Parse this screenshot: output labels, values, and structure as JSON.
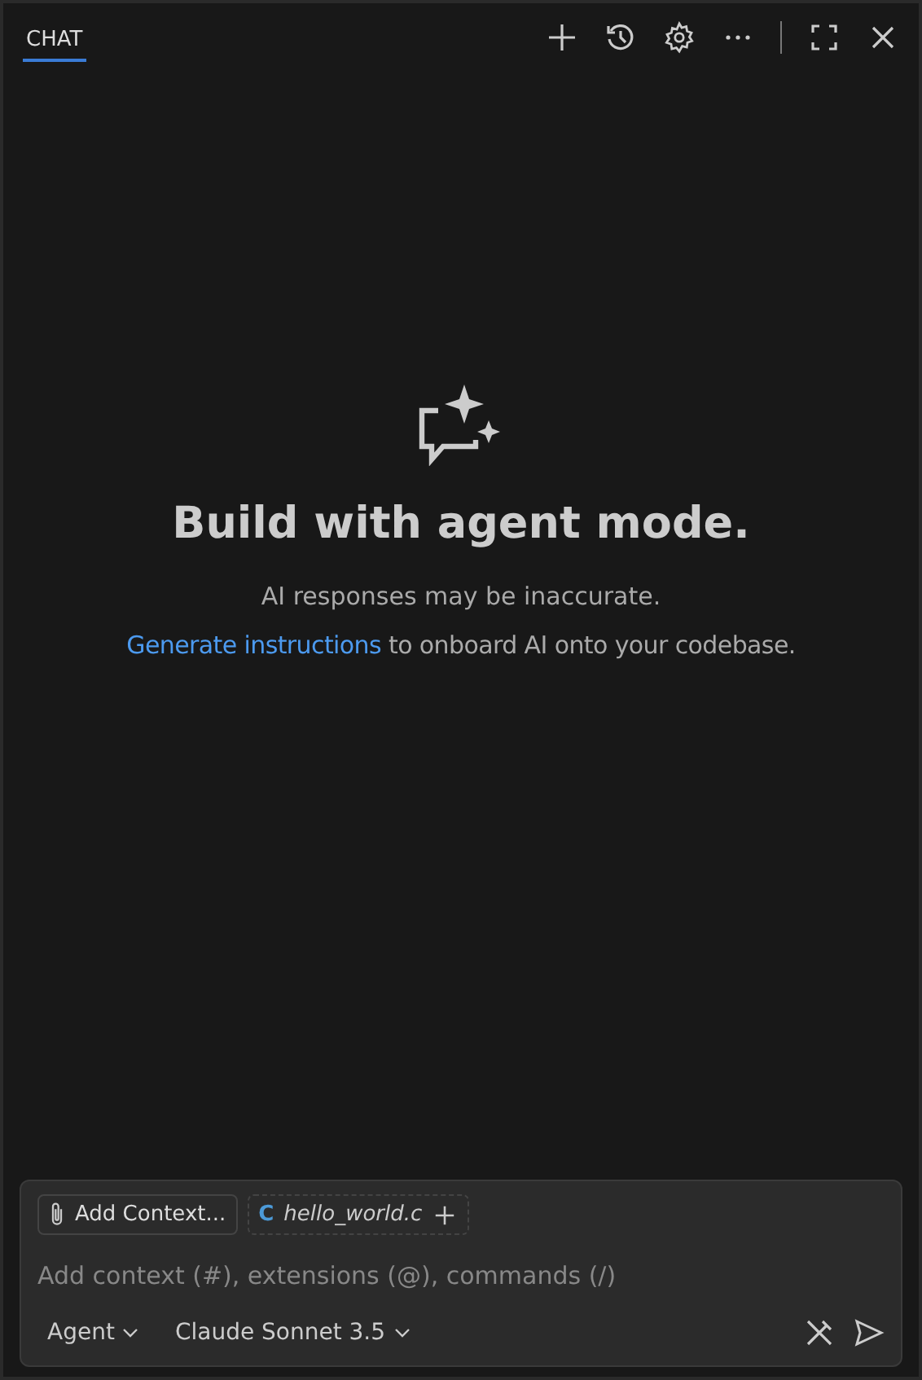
{
  "header": {
    "tabs": [
      {
        "label": "CHAT",
        "selected": true
      }
    ]
  },
  "welcome": {
    "title": "Build with agent mode.",
    "disclaimer": "AI responses may be inaccurate.",
    "link": "Generate instructions",
    "hint": " to onboard AI onto your codebase."
  },
  "input": {
    "chips": [
      {
        "kind": "attach",
        "label": "Add Context..."
      },
      {
        "kind": "file",
        "badge": "C",
        "label": "hello_world.c"
      }
    ],
    "placeholder": "Add context (#), extensions (@), commands (/)",
    "pickers": [
      "Agent",
      "Claude Sonnet 3.5"
    ]
  }
}
